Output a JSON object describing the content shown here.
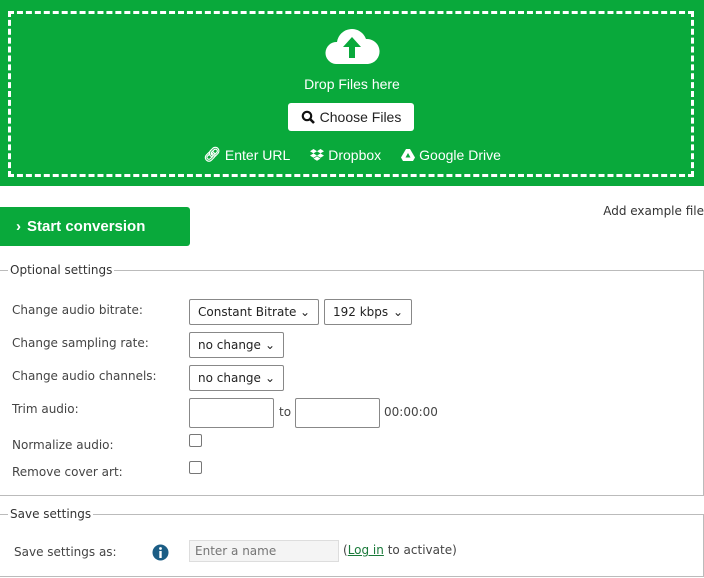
{
  "colors": {
    "accent": "#09a93b"
  },
  "upload": {
    "icon": "cloud-upload-icon",
    "drop_text": "Drop Files here",
    "choose_label": "Choose Files",
    "sources": [
      {
        "icon": "link-icon",
        "label": "Enter URL"
      },
      {
        "icon": "dropbox-icon",
        "label": "Dropbox"
      },
      {
        "icon": "google-drive-icon",
        "label": "Google Drive"
      }
    ]
  },
  "actions": {
    "start_label": "Start conversion",
    "example_label": "Add example file"
  },
  "optional": {
    "legend": "Optional settings",
    "bitrate": {
      "label": "Change audio bitrate:",
      "mode": "Constant Bitrate",
      "value": "192 kbps"
    },
    "sampling": {
      "label": "Change sampling rate:",
      "value": "no change"
    },
    "channels": {
      "label": "Change audio channels:",
      "value": "no change"
    },
    "trim": {
      "label": "Trim audio:",
      "from": "",
      "to_label": "to",
      "to": "",
      "duration": "00:00:00"
    },
    "normalize": {
      "label": "Normalize audio:",
      "checked": false
    },
    "cover": {
      "label": "Remove cover art:",
      "checked": false
    }
  },
  "save": {
    "legend": "Save settings",
    "label": "Save settings as:",
    "placeholder": "Enter a name",
    "paren_open": "(",
    "login": "Log in",
    "suffix": " to activate)"
  }
}
